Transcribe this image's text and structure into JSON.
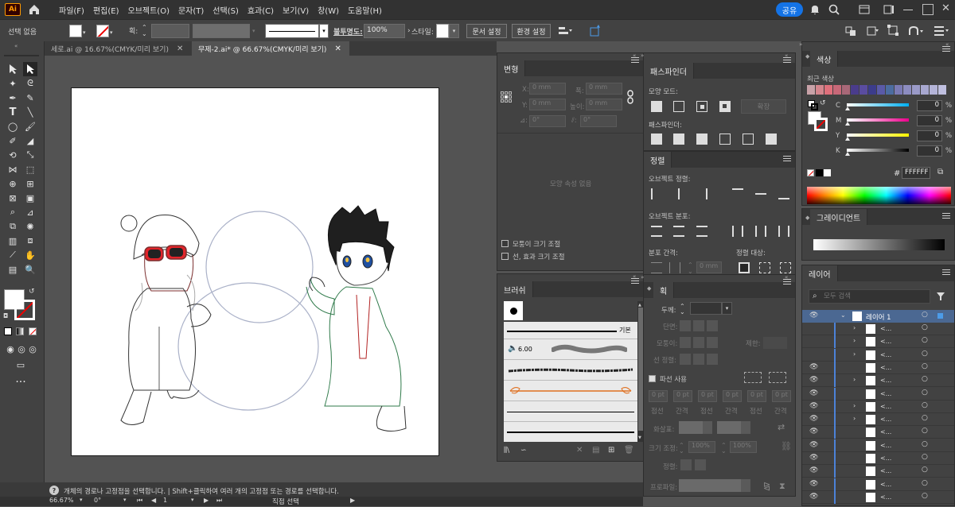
{
  "menubar": {
    "logo": "Ai",
    "items": [
      "파일(F)",
      "편집(E)",
      "오브젝트(O)",
      "문자(T)",
      "선택(S)",
      "효과(C)",
      "보기(V)",
      "창(W)",
      "도움말(H)"
    ],
    "share_label": "공유"
  },
  "controlbar": {
    "selection": "선택 없음",
    "stroke_label": "획:",
    "stroke_line_label": "기본",
    "opacity_label": "불투명도:",
    "opacity_value": "100%",
    "style_label": "스타일:",
    "doc_setup": "문서 설정",
    "prefs": "환경 설정"
  },
  "tabs": [
    {
      "label": "세로.ai @ 16.67%(CMYK/미리 보기)",
      "active": false
    },
    {
      "label": "무제-2.ai* @ 66.67%(CMYK/미리 보기)",
      "active": true
    }
  ],
  "transform": {
    "title": "변형",
    "x_label": "X:",
    "x_value": "0 mm",
    "y_label": "Y:",
    "y_value": "0 mm",
    "w_label": "폭:",
    "w_value": "0 mm",
    "h_label": "높이:",
    "h_value": "0 mm",
    "angle_value": "0°",
    "empty_text": "모양 속성 없음",
    "scale_corners": "모퉁이 크기 조절",
    "scale_strokes": "선, 효과 크기 조절"
  },
  "brush": {
    "title": "브러쉬",
    "basic_label": "기본",
    "size_label": "6.00"
  },
  "pathfinder": {
    "title": "패스파인더",
    "shape_modes": "모양 모드:",
    "expand": "확장",
    "pathfinders": "패스파인더:"
  },
  "align": {
    "title": "정렬",
    "align_objects": "오브젝트 정렬:",
    "distribute_objects": "오브젝트 분포:",
    "distribute_spacing": "분포 간격:",
    "align_to": "정렬 대상:",
    "spacing_value": "0 mm"
  },
  "stroke": {
    "title": "획",
    "weight_label": "두께:",
    "cap_label": "단면:",
    "corner_label": "모퉁이:",
    "limit_label": "제한:",
    "align_label": "선 정렬:",
    "dashed": "파선 사용",
    "dash_values": [
      "0 pt",
      "0 pt",
      "0 pt",
      "0 pt",
      "0 pt",
      "0 pt"
    ],
    "dash_labels": [
      "점선",
      "간격",
      "점선",
      "간격",
      "점선",
      "간격"
    ],
    "arrow_label": "화살표:",
    "scale_label": "크기 조정:",
    "scale_a": "100%",
    "scale_b": "100%",
    "align2_label": "정렬:",
    "profile_label": "프로파일:"
  },
  "color": {
    "title": "색상",
    "recent": "최근 색상",
    "channels": [
      {
        "name": "C",
        "value": "0",
        "unit": "%",
        "color": "#00aeef"
      },
      {
        "name": "M",
        "value": "0",
        "unit": "%",
        "color": "#ec008c"
      },
      {
        "name": "Y",
        "value": "0",
        "unit": "%",
        "color": "#fff200"
      },
      {
        "name": "K",
        "value": "0",
        "unit": "%",
        "color": "#000000"
      }
    ],
    "hex_value": "FFFFFF",
    "recent_swatches": [
      "#c8a2a8",
      "#d4868e",
      "#e0707c",
      "#c86878",
      "#a86878",
      "#4a3c8c",
      "#5a4ca0",
      "#3c3c8c",
      "#5a5aa8",
      "#4c6ca0",
      "#7a7ab4",
      "#8c8cc0",
      "#9a9ac8",
      "#a8a8d0",
      "#b4b4d8",
      "#c0c0e0"
    ]
  },
  "gradient": {
    "title": "그레이디언트"
  },
  "layers": {
    "title": "레이어",
    "search_placeholder": "모두 검색",
    "layer1": "레이어 1",
    "sublayer": "<..."
  },
  "status": {
    "hint": "개체의 경로나 고정점을 선택합니다.  |  Shift+클릭하여 여러 개의 고정점 또는 경로를 선택합니다.",
    "zoom": "66.67%",
    "rotate": "0°",
    "page": "1",
    "tool": "직접 선택"
  }
}
